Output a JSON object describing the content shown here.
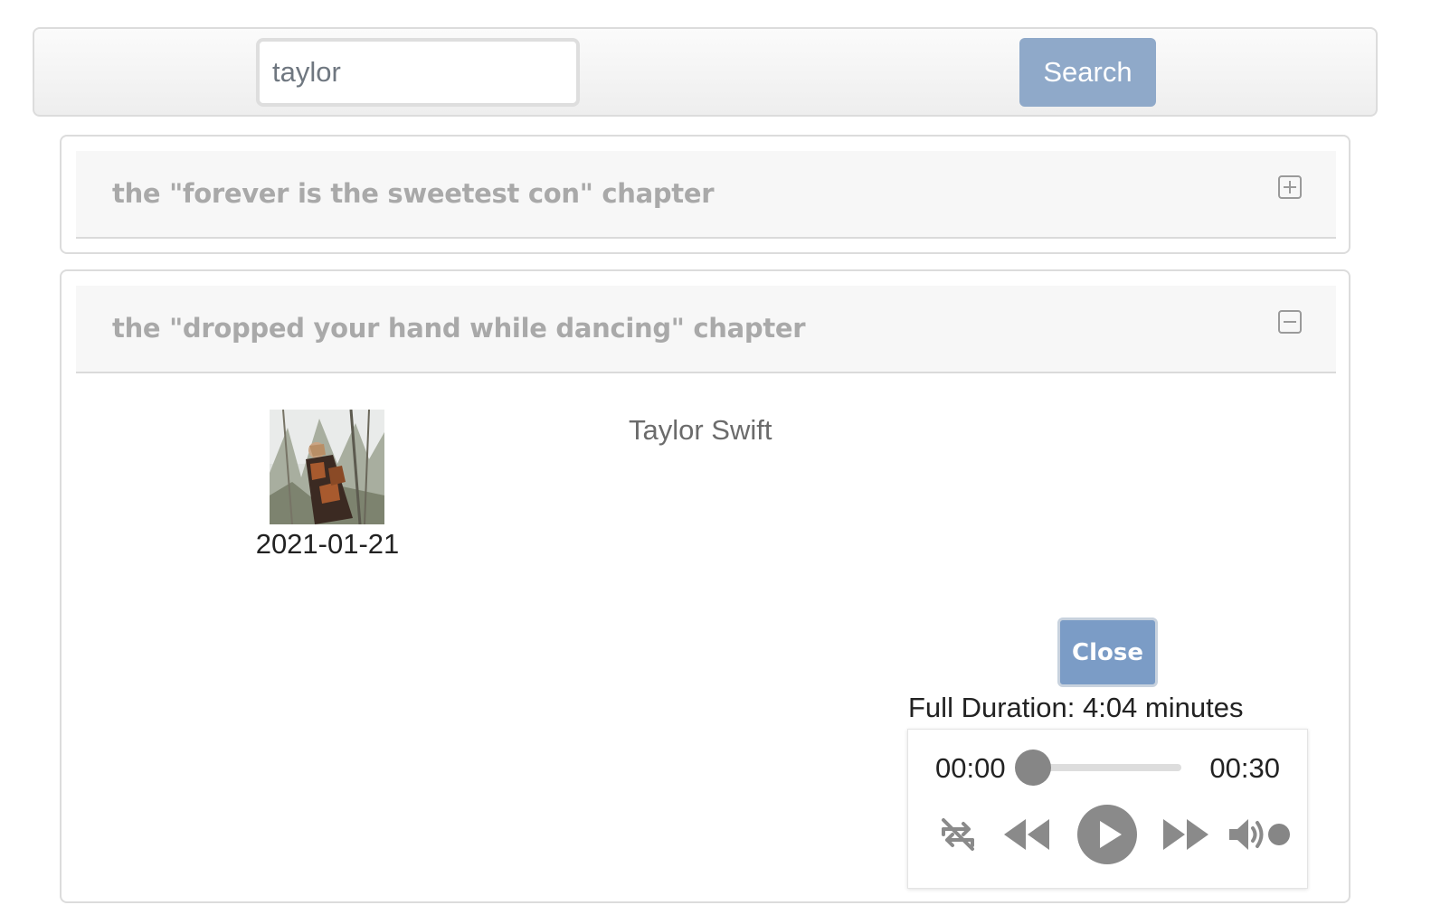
{
  "search": {
    "value": "taylor",
    "button_label": "Search"
  },
  "results": [
    {
      "title": "the \"forever is the sweetest con\" chapter",
      "expanded": false,
      "toggle_icon": "plus-square-icon"
    },
    {
      "title": "the \"dropped your hand while dancing\" chapter",
      "expanded": true,
      "toggle_icon": "minus-square-icon",
      "release_date": "2021-01-21",
      "artist": "Taylor Swift",
      "close_label": "Close",
      "duration_label": "Full Duration: 4:04 minutes"
    }
  ],
  "player": {
    "current_time": "00:00",
    "duration": "00:30",
    "progress": 0,
    "controls": [
      "repeat-off-icon",
      "rewind-icon",
      "play-icon",
      "fast-forward-icon",
      "volume-icon"
    ]
  },
  "colors": {
    "button_blue": "#8fa9c9",
    "close_blue": "#7b9cc6",
    "title_gray": "#a9a9a9",
    "player_gray": "#868686"
  }
}
